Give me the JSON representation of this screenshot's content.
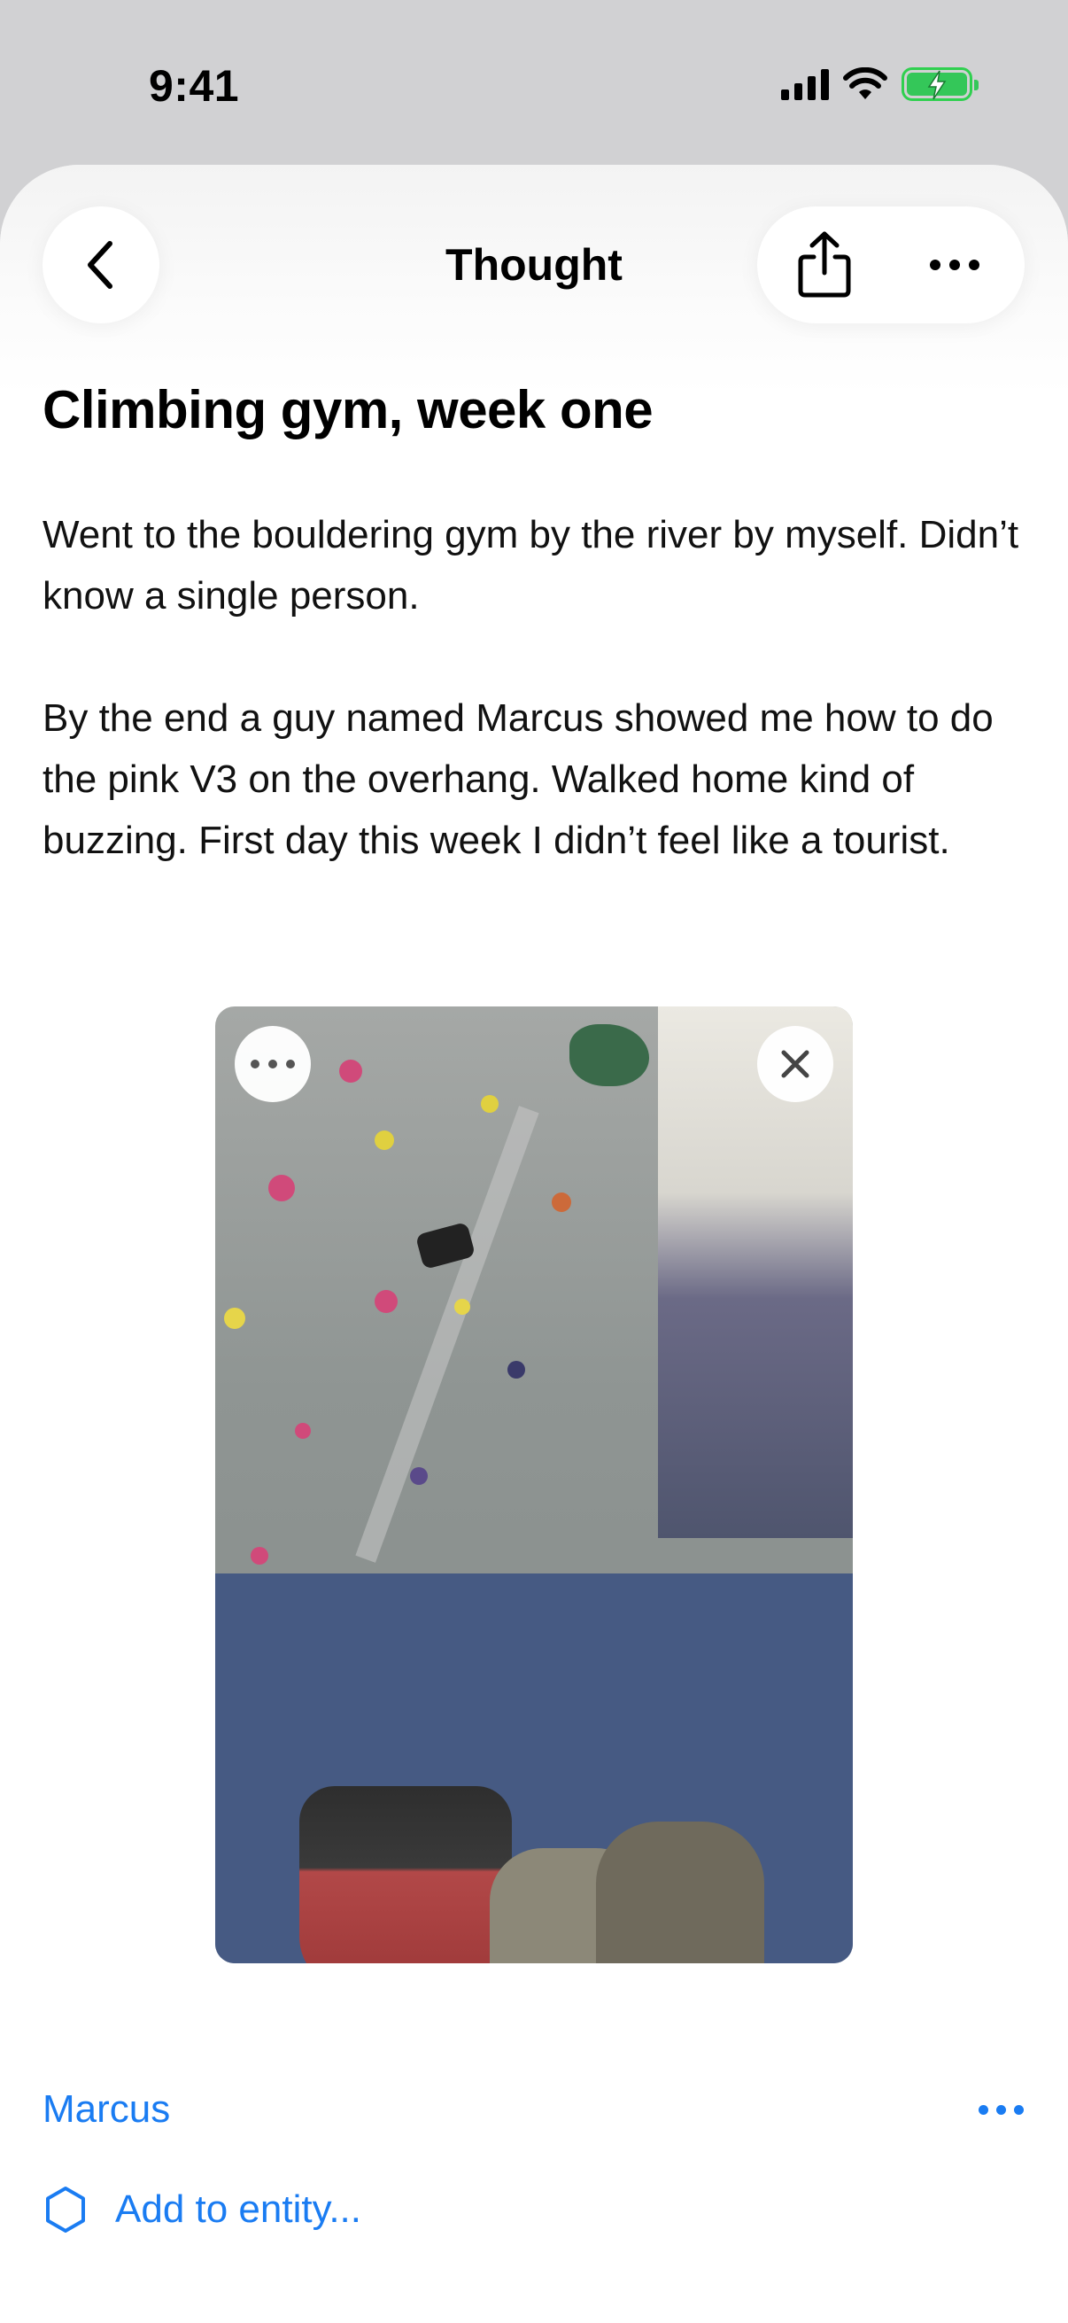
{
  "status_bar": {
    "time": "9:41"
  },
  "nav": {
    "title": "Thought"
  },
  "note": {
    "title": "Climbing gym, week one",
    "paragraphs": [
      "Went to the bouldering gym by the river by myself. Didn’t know a single person.",
      "By the end a guy named Marcus showed me how to do the pink V3 on the overhang. Walked home kind of buzzing. First day this week I didn’t feel like a tourist."
    ]
  },
  "links": {
    "entity_name": "Marcus",
    "add_entity_label": "Add to entity..."
  },
  "colors": {
    "accent": "#1a7cf2",
    "battery": "#34c759"
  }
}
